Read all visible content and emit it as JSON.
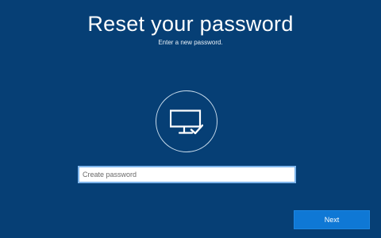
{
  "page": {
    "title": "Reset your password",
    "subtitle": "Enter a new password."
  },
  "icon": {
    "name": "monitor-check-icon"
  },
  "password_field": {
    "placeholder": "Create password",
    "value": ""
  },
  "actions": {
    "next_label": "Next"
  },
  "colors": {
    "background": "#063f75",
    "button": "#0f78d5",
    "input_border": "#7fb6ec",
    "text": "#ffffff"
  }
}
